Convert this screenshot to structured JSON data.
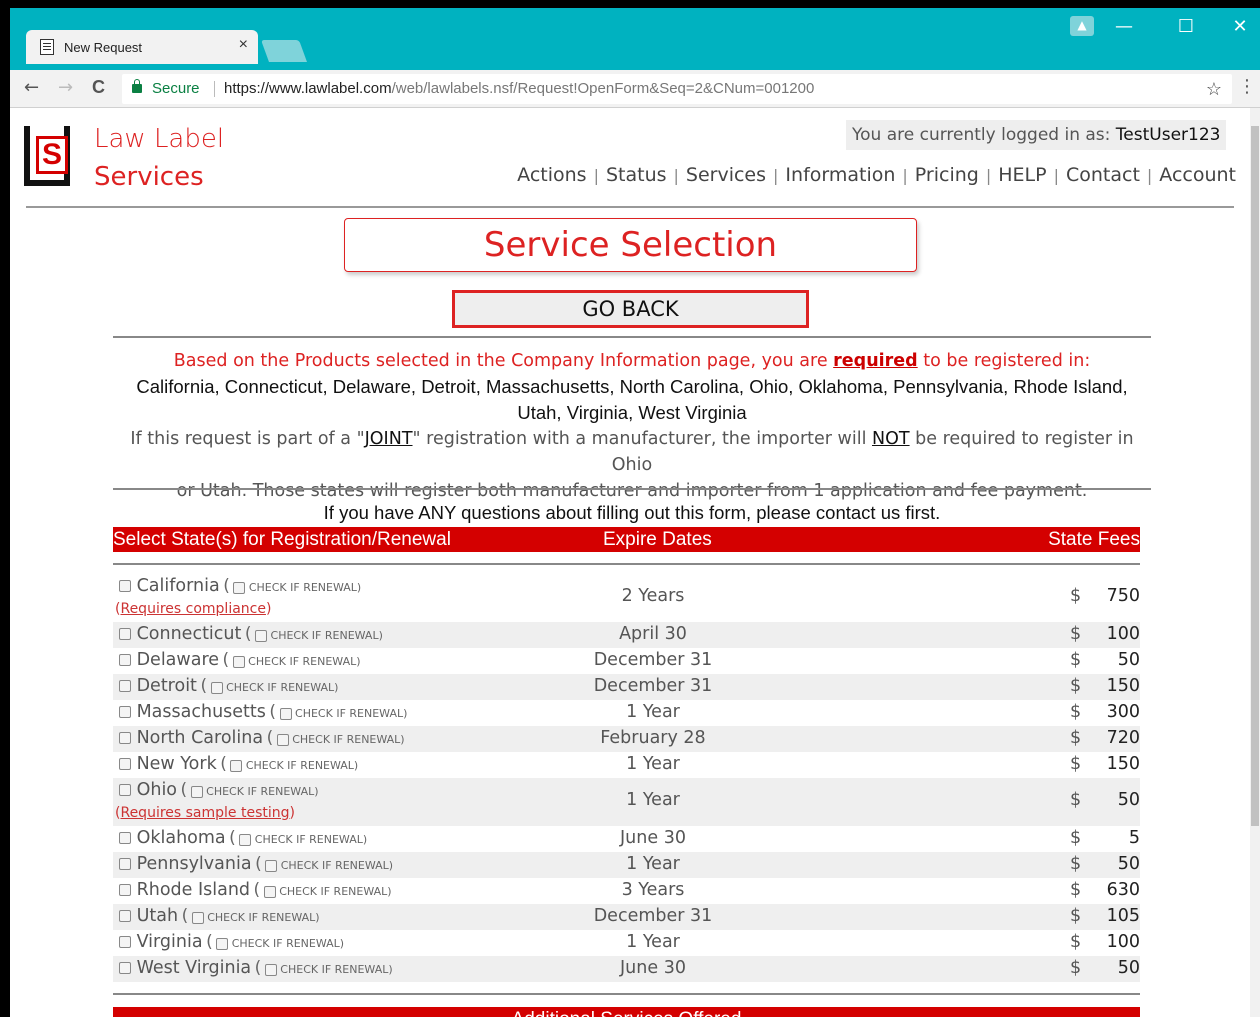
{
  "browser": {
    "tab_title": "New Request",
    "tab_close": "×",
    "secure_label": "Secure",
    "url_domain": "https://www.lawlabel.com",
    "url_path": "/web/lawlabels.nsf/Request!OpenForm&Seq=2&CNum=001200",
    "profile_glyph": "▲",
    "minimize": "—",
    "maximize": "☐",
    "close": "✕",
    "back": "←",
    "forward": "→",
    "reload": "C",
    "bookmark": "☆",
    "menu": "⋮"
  },
  "header": {
    "brand_line1": "Law Label",
    "brand_line2": "Services",
    "logo_letter": "S",
    "login_prefix": "You are currently logged in as:",
    "login_user": "TestUser123",
    "nav": [
      "Actions",
      "Status",
      "Services",
      "Information",
      "Pricing",
      "HELP",
      "Contact",
      "Account"
    ],
    "nav_separator": "|"
  },
  "main": {
    "title": "Service Selection",
    "go_back": "GO BACK",
    "info_red_1": "Based on the Products selected in the Company Information page, you are ",
    "info_required": "required",
    "info_red_2": " to be registered in:",
    "required_states_line1": "California, Connecticut, Delaware, Detroit, Massachusetts, North Carolina, Ohio, Oklahoma, Pennsylvania, Rhode Island,",
    "required_states_line2": "Utah, Virginia, West Virginia",
    "joint_1": "If this request is part of a \"",
    "joint_word": "JOINT",
    "joint_2": "\" registration with a manufacturer, the importer will ",
    "joint_not": "NOT",
    "joint_3": " be required to register in Ohio",
    "joint_4": "or Utah. Those states will register both manufacturer and importer from 1 application and fee payment.",
    "questions": "If you have ANY questions about filling out this form, please contact us first."
  },
  "table": {
    "headers": [
      "Select State(s) for Registration/Renewal",
      "Expire Dates",
      "State Fees"
    ],
    "renewal_label": "CHECK IF RENEWAL)",
    "paren_open": "(",
    "dollar": "$",
    "rows": [
      {
        "state": "California",
        "expire": "2 Years",
        "fee": "750",
        "note": "Requires compliance"
      },
      {
        "state": "Connecticut",
        "expire": "April 30",
        "fee": "100",
        "note": ""
      },
      {
        "state": "Delaware",
        "expire": "December 31",
        "fee": "50",
        "note": ""
      },
      {
        "state": "Detroit",
        "expire": "December 31",
        "fee": "150",
        "note": ""
      },
      {
        "state": "Massachusetts",
        "expire": "1 Year",
        "fee": "300",
        "note": ""
      },
      {
        "state": "North Carolina",
        "expire": "February 28",
        "fee": "720",
        "note": ""
      },
      {
        "state": "New York",
        "expire": "1 Year",
        "fee": "150",
        "note": ""
      },
      {
        "state": "Ohio",
        "expire": "1 Year",
        "fee": "50",
        "note": "Requires sample testing"
      },
      {
        "state": "Oklahoma",
        "expire": "June 30",
        "fee": "5",
        "note": ""
      },
      {
        "state": "Pennsylvania",
        "expire": "1 Year",
        "fee": "50",
        "note": ""
      },
      {
        "state": "Rhode Island",
        "expire": "3 Years",
        "fee": "630",
        "note": ""
      },
      {
        "state": "Utah",
        "expire": "December 31",
        "fee": "105",
        "note": ""
      },
      {
        "state": "Virginia",
        "expire": "1 Year",
        "fee": "100",
        "note": ""
      },
      {
        "state": "West Virginia",
        "expire": "June 30",
        "fee": "50",
        "note": ""
      }
    ]
  },
  "additional": {
    "header": "Additional Services Offered"
  },
  "colors": {
    "titlebar": "#00b2c0",
    "brand_red": "#d40000",
    "secure_green": "#0b8043"
  }
}
